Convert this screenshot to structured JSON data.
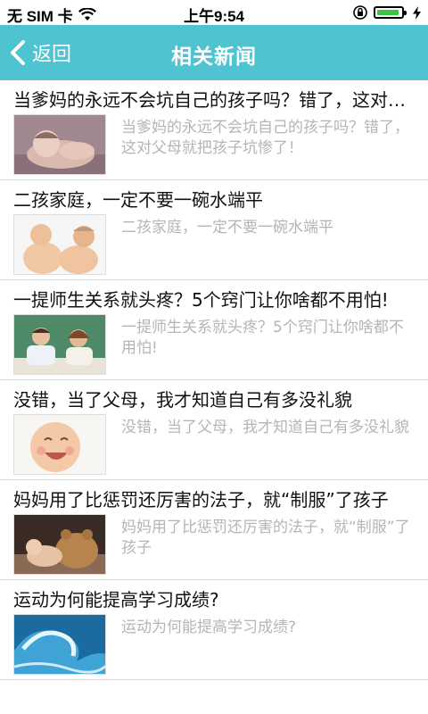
{
  "status_bar": {
    "carrier": "无 SIM 卡",
    "time": "上午9:54",
    "icons": [
      "wifi-icon",
      "orientation-lock-icon",
      "battery-icon",
      "charging-bolt-icon"
    ]
  },
  "navbar": {
    "back_label": "返回",
    "title": "相关新闻",
    "background_color": "#4fc3cf"
  },
  "news": [
    {
      "title": "当爹妈的永远不会坑自己的孩子吗？错了，这对父母就把孩子坑惨了！",
      "description": "当爹妈的永远不会坑自己的孩子吗？错了，这对父母就把孩子坑惨了！",
      "thumbnail": "sleeping-baby-photo"
    },
    {
      "title": "二孩家庭，一定不要一碗水端平",
      "description": "二孩家庭，一定不要一碗水端平",
      "thumbnail": "two-babies-photo"
    },
    {
      "title": "一提师生关系就头疼？5个窍门让你啥都不用怕!",
      "description": "一提师生关系就头疼？5个窍门让你啥都不用怕!",
      "thumbnail": "teacher-student-photo"
    },
    {
      "title": "没错，当了父母，我才知道自己有多没礼貌",
      "description": "没错，当了父母，我才知道自己有多没礼貌",
      "thumbnail": "laughing-baby-photo"
    },
    {
      "title": "妈妈用了比惩罚还厉害的法子，就“制服”了孩子",
      "description": "妈妈用了比惩罚还厉害的法子，就“制服”了孩子",
      "thumbnail": "baby-teddy-bear-photo"
    },
    {
      "title": "运动为何能提高学习成绩?",
      "description": "运动为何能提高学习成绩?",
      "thumbnail": "ocean-wave-photo"
    }
  ]
}
